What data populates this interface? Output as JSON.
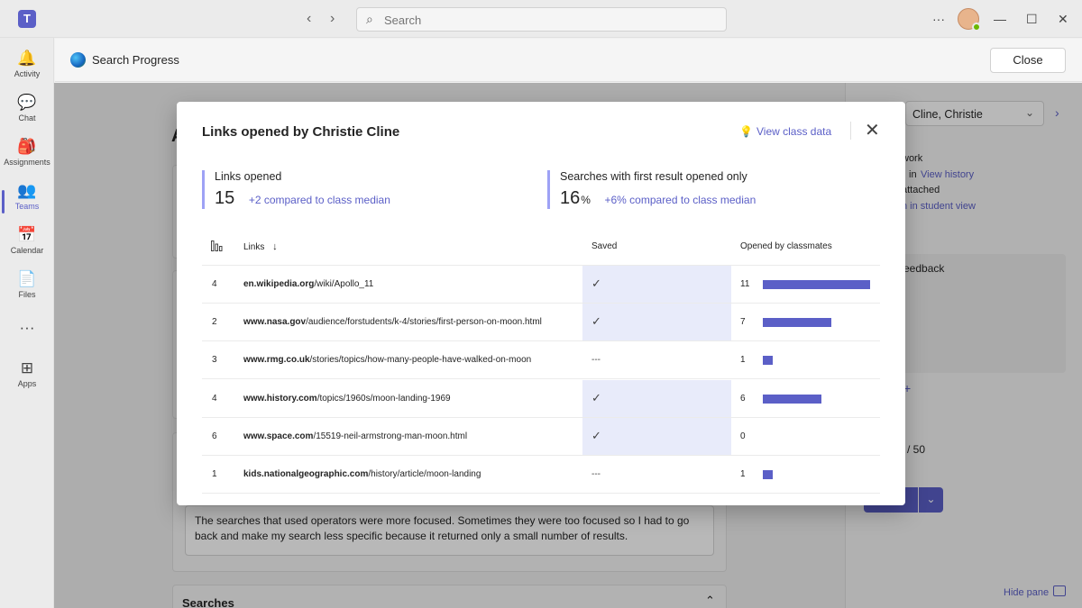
{
  "titlebar": {
    "app_initial": "T",
    "back_icon": "‹",
    "forward_icon": "›",
    "search_icon": "⌕",
    "search_placeholder": "Search",
    "more_icon": "···",
    "minimize_icon": "—",
    "maximize_icon": "☐",
    "close_icon": "✕"
  },
  "rail": {
    "items": [
      {
        "label": "Activity",
        "icon": "🔔"
      },
      {
        "label": "Chat",
        "icon": "💬"
      },
      {
        "label": "Assignments",
        "icon": "🎒"
      },
      {
        "label": "Teams",
        "icon": "👥"
      },
      {
        "label": "Calendar",
        "icon": "📅"
      },
      {
        "label": "Files",
        "icon": "📄"
      },
      {
        "label": "",
        "icon": "···"
      },
      {
        "label": "Apps",
        "icon": "⊞"
      }
    ],
    "active": "Teams"
  },
  "app_header": {
    "title": "Search Progress",
    "close_label": "Close"
  },
  "background": {
    "student_select": "Cline, Christie",
    "work_text": "work",
    "in_text": "in",
    "view_history": "View history",
    "attached_text": "attached",
    "student_view_text": "n in student view",
    "feedback_text": "eedback",
    "plus_text": "+",
    "points_text": "/ 50",
    "reflection_text_1": "The searches that used operators were more focused. Sometimes they were too focused so I had to go",
    "reflection_text_2": "back and make my search less specific because it returned only a small number of results.",
    "searches_heading": "Searches",
    "hide_pane": "Hide pane",
    "section_letter": "A"
  },
  "modal": {
    "title": "Links opened by Christie Cline",
    "view_class_data": "View class data",
    "close_icon": "✕",
    "stats": {
      "links_opened_label": "Links opened",
      "links_opened_value": "15",
      "links_opened_compare": "+2 compared to class median",
      "first_result_label": "Searches with first result opened only",
      "first_result_value": "16",
      "first_result_unit": "%",
      "first_result_compare": "+6% compared to class median"
    },
    "table": {
      "col_count_icon": "bar-chart-icon",
      "col_links": "Links",
      "sort_icon": "↓",
      "col_saved": "Saved",
      "col_opened": "Opened by classmates",
      "max_opened": 11,
      "rows": [
        {
          "count": "4",
          "domain": "en.wikipedia.org",
          "path": "/wiki/Apollo_11",
          "saved": true,
          "saved_dash": "",
          "opened": 11
        },
        {
          "count": "2",
          "domain": "www.nasa.gov",
          "path": "/audience/forstudents/k-4/stories/first-person-on-moon.html",
          "saved": true,
          "saved_dash": "",
          "opened": 7
        },
        {
          "count": "3",
          "domain": "www.rmg.co.uk",
          "path": "/stories/topics/how-many-people-have-walked-on-moon",
          "saved": false,
          "saved_dash": "---",
          "opened": 1
        },
        {
          "count": "4",
          "domain": "www.history.com",
          "path": "/topics/1960s/moon-landing-1969",
          "saved": true,
          "saved_dash": "",
          "opened": 6
        },
        {
          "count": "6",
          "domain": "www.space.com",
          "path": "/15519-neil-armstrong-man-moon.html",
          "saved": true,
          "saved_dash": "",
          "opened": 0
        },
        {
          "count": "1",
          "domain": "kids.nationalgeographic.com",
          "path": "/history/article/moon-landing",
          "saved": false,
          "saved_dash": "---",
          "opened": 1
        }
      ]
    }
  },
  "colors": {
    "accent": "#5b5fc7",
    "saved_highlight": "#e8ebfa",
    "stat_border": "#9ea2f5"
  }
}
